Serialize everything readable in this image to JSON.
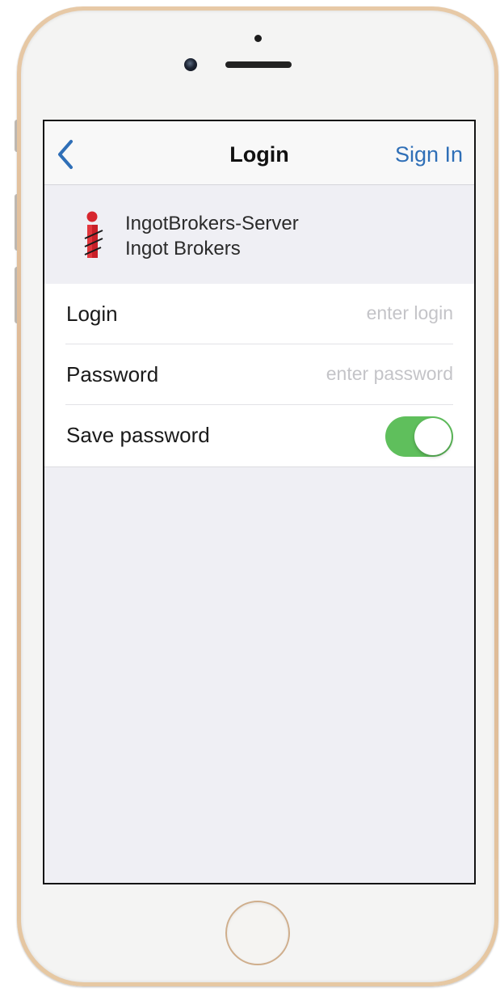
{
  "nav": {
    "back_icon": "chevron-left-icon",
    "title": "Login",
    "sign_in_label": "Sign In"
  },
  "server": {
    "logo_icon": "ingot-brokers-logo",
    "name": "IngotBrokers-Server",
    "broker": "Ingot Brokers"
  },
  "form": {
    "login": {
      "label": "Login",
      "value": "",
      "placeholder": "enter login"
    },
    "password": {
      "label": "Password",
      "value": "",
      "placeholder": "enter password"
    },
    "save_password": {
      "label": "Save password",
      "on": true
    }
  },
  "colors": {
    "accent_blue": "#2f6fb7",
    "toggle_on": "#5fbf5c",
    "logo_red": "#d7262e",
    "background": "#efeff4"
  }
}
